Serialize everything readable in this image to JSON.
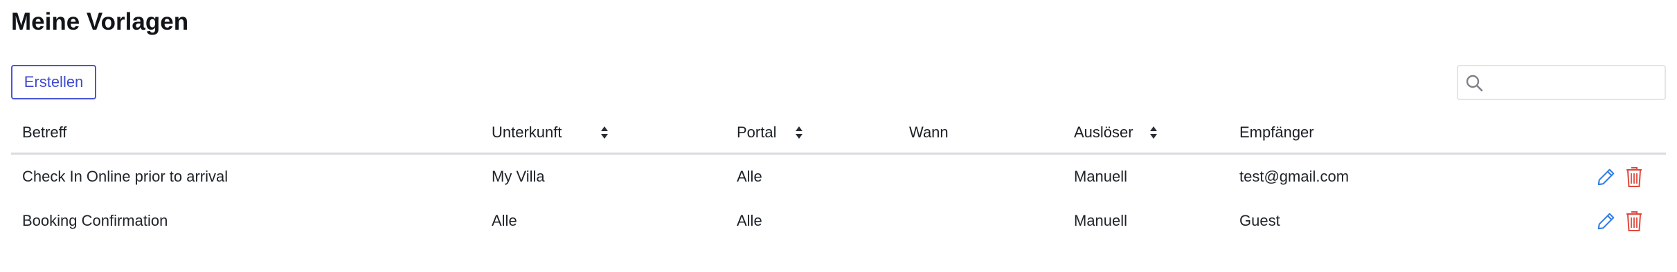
{
  "page": {
    "title": "Meine Vorlagen"
  },
  "toolbar": {
    "create_label": "Erstellen",
    "search_placeholder": "",
    "search_value": ""
  },
  "table": {
    "columns": [
      {
        "label": "Betreff",
        "sortable": false
      },
      {
        "label": "Unterkunft",
        "sortable": true
      },
      {
        "label": "Portal",
        "sortable": true
      },
      {
        "label": "Wann",
        "sortable": false
      },
      {
        "label": "Auslöser",
        "sortable": true
      },
      {
        "label": "Empfänger",
        "sortable": false
      }
    ],
    "rows": [
      {
        "betreff": "Check In Online prior to arrival",
        "unterkunft": "My Villa",
        "portal": "Alle",
        "wann": "",
        "ausloeser": "Manuell",
        "empfaenger": "test@gmail.com"
      },
      {
        "betreff": "Booking Confirmation",
        "unterkunft": "Alle",
        "portal": "Alle",
        "wann": "",
        "ausloeser": "Manuell",
        "empfaenger": "Guest"
      }
    ]
  },
  "icons": {
    "search": "search-icon",
    "sort": "sort-arrows-icon",
    "edit": "pencil-icon",
    "delete": "trash-icon"
  },
  "colors": {
    "accent": "#3f4bd1",
    "edit": "#2f7de1",
    "delete": "#e0493f",
    "header_border": "#d9dbdf"
  }
}
